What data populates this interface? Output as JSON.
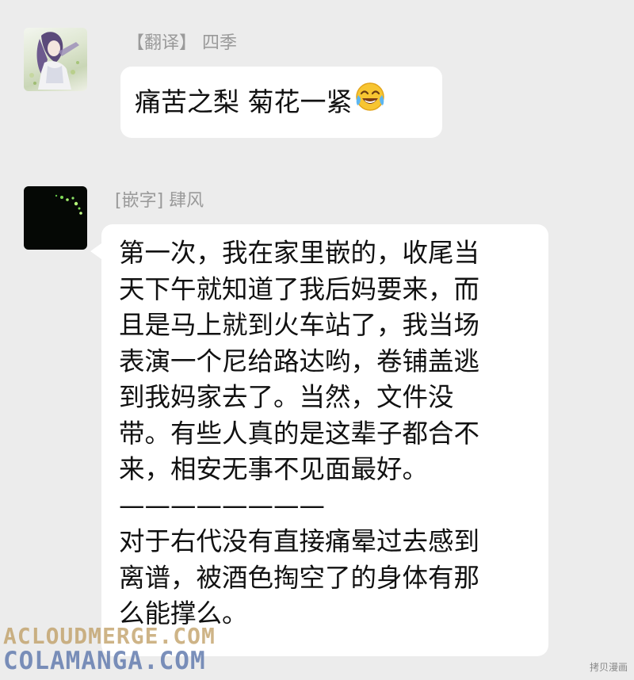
{
  "messages": [
    {
      "sender": "【翻译】 四季",
      "text": "痛苦之梨  菊花一紧",
      "emoji": "face-with-tears-of-joy"
    },
    {
      "sender": "[嵌字] 肆风",
      "lines": [
        "第一次，我在家里嵌的，收尾当",
        "天下午就知道了我后妈要来，而",
        "且是马上就到火车站了，我当场",
        "表演一个尼给路达哟，卷铺盖逃",
        "到我妈家去了。当然，文件没",
        "带。有些人真的是这辈子都合不",
        "来，相安无事不见面最好。",
        "————————",
        "对于右代没有直接痛晕过去感到",
        "离谱，被酒色掏空了的身体有那",
        "么能撑么。"
      ]
    }
  ],
  "watermarks": {
    "line1": "ACLOUDMERGE.COM",
    "line2": "COLAMANGA.COM",
    "corner": "拷贝漫画"
  },
  "colors": {
    "background": "#ececec",
    "bubble": "#ffffff",
    "sender_text": "#9a9a9a",
    "message_text": "#111111"
  }
}
